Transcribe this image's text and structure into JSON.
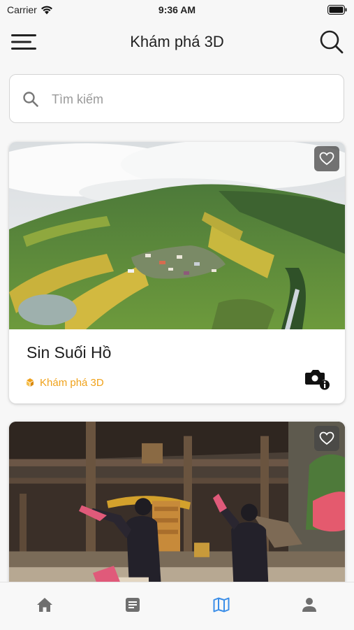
{
  "status_bar": {
    "carrier": "Carrier",
    "time": "9:36 AM"
  },
  "nav": {
    "title": "Khám phá 3D",
    "menu_icon": "hamburger-icon",
    "search_icon": "search-icon"
  },
  "search": {
    "placeholder": "Tìm kiếm",
    "value": ""
  },
  "cards": [
    {
      "title": "Sin Suối Hồ",
      "category": "Khám phá 3D",
      "image": "aerial-terraced-village-photo",
      "favorite_icon": "heart-outline-icon",
      "info_icon": "camera-info-icon"
    },
    {
      "image": "village-house-dancers-photo",
      "favorite_icon": "heart-outline-icon"
    }
  ],
  "tabs": [
    {
      "icon": "home-icon",
      "active": false
    },
    {
      "icon": "article-icon",
      "active": false
    },
    {
      "icon": "map-icon",
      "active": true
    },
    {
      "icon": "profile-icon",
      "active": false
    }
  ],
  "colors": {
    "accent": "#f0a21a",
    "active_tab": "#3b8ee8",
    "inactive_tab": "#6f6f6f"
  }
}
